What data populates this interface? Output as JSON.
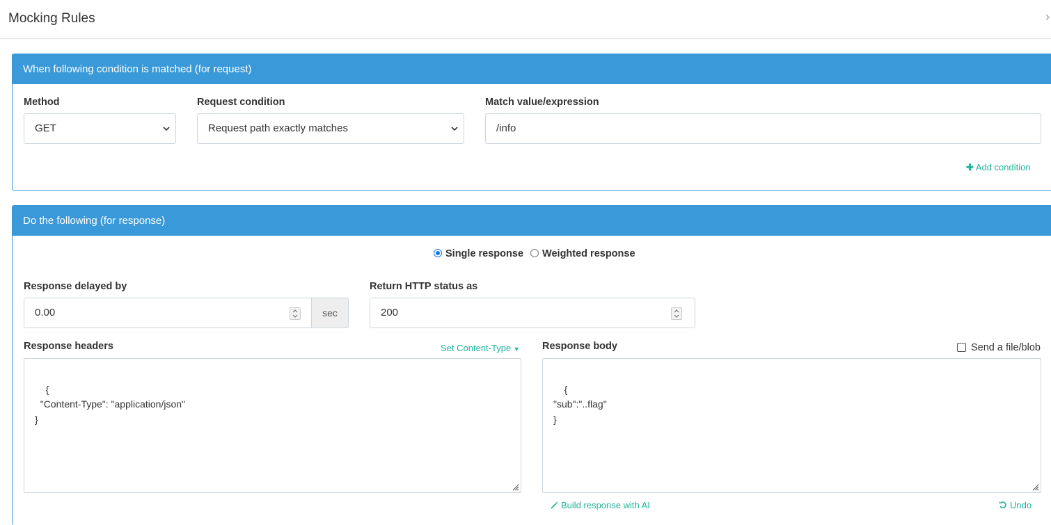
{
  "window": {
    "title": "Mocking Rules"
  },
  "request_panel": {
    "header": "When following condition is matched (for request)",
    "method": {
      "label": "Method",
      "value": "GET"
    },
    "condition": {
      "label": "Request condition",
      "value": "Request path exactly matches"
    },
    "match": {
      "label": "Match value/expression",
      "value": "/info"
    },
    "add_condition": "Add condition"
  },
  "response_panel": {
    "header": "Do the following (for response)",
    "mode": {
      "single": "Single response",
      "weighted": "Weighted response",
      "selected": "single"
    },
    "delay": {
      "label": "Response delayed by",
      "value": "0.00",
      "unit": "sec"
    },
    "status": {
      "label": "Return HTTP status as",
      "value": "200"
    },
    "headers": {
      "label": "Response headers",
      "set_content_type": "Set Content-Type",
      "value": "{\n  \"Content-Type\": \"application/json\"\n}"
    },
    "body": {
      "label": "Response body",
      "send_file": "Send a file/blob",
      "value": "{\n\"sub\":\"..flag\"\n}"
    },
    "build_ai": "Build response with AI",
    "undo": "Undo"
  },
  "colors": {
    "accent": "#3a99d8",
    "link": "#1fb59a",
    "radio": "#1a73e8"
  }
}
